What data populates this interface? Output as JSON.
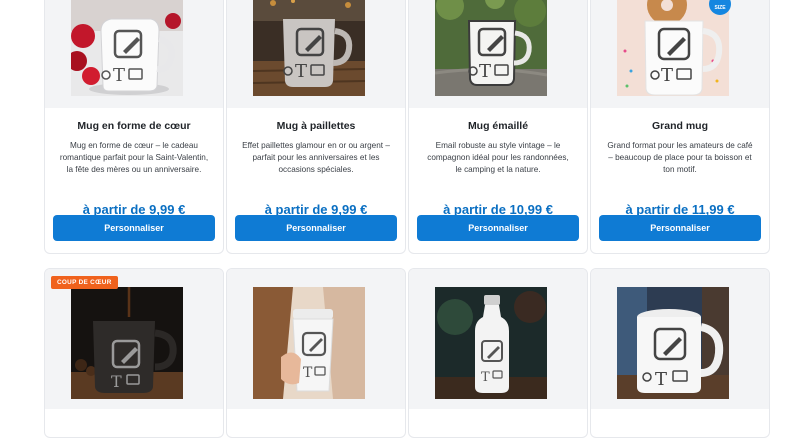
{
  "products_row1": [
    {
      "title": "Mug en forme de cœur",
      "description": "Mug en forme de cœur – le cadeau romantique parfait pour la Saint-Valentin, la fête des mères ou un anniversaire.",
      "price": "à partir de 9,99 €",
      "button": "Personnaliser",
      "icon": "heart-mug-icon"
    },
    {
      "title": "Mug à paillettes",
      "description": "Effet paillettes glamour en or ou argent – parfait pour les anniversaires et les occasions spéciales.",
      "price": "à partir de 9,99 €",
      "button": "Personnaliser",
      "icon": "glitter-mug-icon"
    },
    {
      "title": "Mug émaillé",
      "description": "Email robuste au style vintage – le compagnon idéal pour les randonnées, le camping et la nature.",
      "price": "à partir de 10,99 €",
      "button": "Personnaliser",
      "icon": "enamel-mug-icon"
    },
    {
      "title": "Grand mug",
      "description": "Grand format pour les amateurs de café – beaucoup de place pour ta boisson et ton motif.",
      "price": "à partir de 11,99 €",
      "button": "Personnaliser",
      "icon": "big-mug-icon",
      "size_badge": "SIZE"
    }
  ],
  "products_row2": [
    {
      "badge": "COUP DE CŒUR",
      "icon": "magic-mug-icon"
    },
    {
      "icon": "travel-tumbler-icon"
    },
    {
      "icon": "water-bottle-icon"
    },
    {
      "icon": "beer-stein-icon"
    }
  ],
  "colors": {
    "button": "#0f7bd4",
    "price": "#0a6fc2",
    "badge": "#f0621d"
  }
}
